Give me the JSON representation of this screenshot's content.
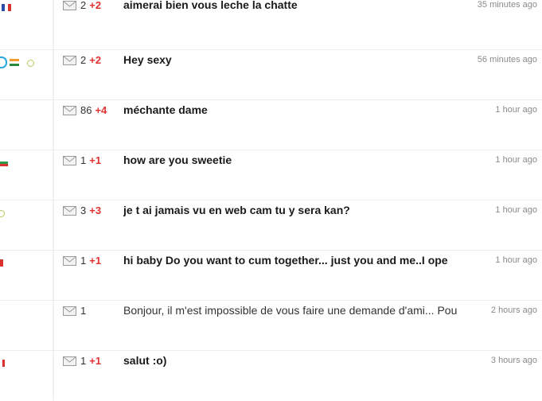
{
  "messages": [
    {
      "count": "2",
      "new": "+2",
      "subject": "aimerai bien vous leche la chatte",
      "time": "35 minutes ago",
      "unread": true
    },
    {
      "count": "2",
      "new": "+2",
      "subject": "Hey sexy",
      "time": "56 minutes ago",
      "unread": true
    },
    {
      "count": "86",
      "new": "+4",
      "subject": "méchante dame",
      "time": "1 hour ago",
      "unread": true
    },
    {
      "count": "1",
      "new": "+1",
      "subject": "how are you sweetie",
      "time": "1 hour ago",
      "unread": true
    },
    {
      "count": "3",
      "new": "+3",
      "subject": "je t ai jamais vu en web cam tu y sera kan?",
      "time": "1 hour ago",
      "unread": true
    },
    {
      "count": "1",
      "new": "+1",
      "subject": "hi baby Do you want to cum together... just you and me..I ope",
      "time": "1 hour ago",
      "unread": true
    },
    {
      "count": "1",
      "new": "",
      "subject": "Bonjour, il m'est impossible de vous faire une demande d'ami... Pou",
      "time": "2 hours ago",
      "unread": false
    },
    {
      "count": "1",
      "new": "+1",
      "subject": "salut :o)",
      "time": "3 hours ago",
      "unread": true
    }
  ],
  "icons": {
    "mail": "envelope-icon",
    "flags": [
      "france-flag-icon",
      "india-flag-icon",
      "bulgaria-flag-icon",
      "flag-icon",
      "canada-flag-icon"
    ],
    "status": "online-status-icon"
  },
  "colors": {
    "new_count": "#e03030",
    "time": "#8a8a8a",
    "separator": "#ececec"
  }
}
